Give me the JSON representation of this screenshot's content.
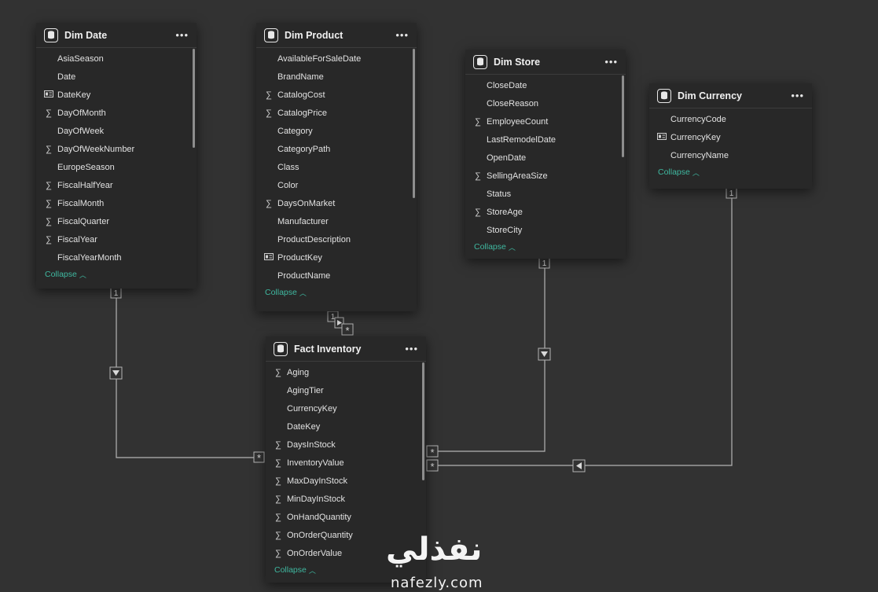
{
  "tables": {
    "dim_date": {
      "title": "Dim Date",
      "fields": [
        {
          "label": "AsiaSeason",
          "icon": ""
        },
        {
          "label": "Date",
          "icon": ""
        },
        {
          "label": "DateKey",
          "icon": "key-card"
        },
        {
          "label": "DayOfMonth",
          "icon": "sigma"
        },
        {
          "label": "DayOfWeek",
          "icon": ""
        },
        {
          "label": "DayOfWeekNumber",
          "icon": "sigma"
        },
        {
          "label": "EuropeSeason",
          "icon": ""
        },
        {
          "label": "FiscalHalfYear",
          "icon": "sigma"
        },
        {
          "label": "FiscalMonth",
          "icon": "sigma"
        },
        {
          "label": "FiscalQuarter",
          "icon": "sigma"
        },
        {
          "label": "FiscalYear",
          "icon": "sigma"
        },
        {
          "label": "FiscalYearMonth",
          "icon": ""
        }
      ],
      "collapse": "Collapse"
    },
    "dim_product": {
      "title": "Dim Product",
      "fields": [
        {
          "label": "AvailableForSaleDate",
          "icon": ""
        },
        {
          "label": "BrandName",
          "icon": ""
        },
        {
          "label": "CatalogCost",
          "icon": "sigma"
        },
        {
          "label": "CatalogPrice",
          "icon": "sigma"
        },
        {
          "label": "Category",
          "icon": ""
        },
        {
          "label": "CategoryPath",
          "icon": ""
        },
        {
          "label": "Class",
          "icon": ""
        },
        {
          "label": "Color",
          "icon": ""
        },
        {
          "label": "DaysOnMarket",
          "icon": "sigma"
        },
        {
          "label": "Manufacturer",
          "icon": ""
        },
        {
          "label": "ProductDescription",
          "icon": ""
        },
        {
          "label": "ProductKey",
          "icon": "key-card"
        },
        {
          "label": "ProductName",
          "icon": ""
        }
      ],
      "collapse": "Collapse"
    },
    "dim_store": {
      "title": "Dim Store",
      "fields": [
        {
          "label": "CloseDate",
          "icon": ""
        },
        {
          "label": "CloseReason",
          "icon": ""
        },
        {
          "label": "EmployeeCount",
          "icon": "sigma"
        },
        {
          "label": "LastRemodelDate",
          "icon": ""
        },
        {
          "label": "OpenDate",
          "icon": ""
        },
        {
          "label": "SellingAreaSize",
          "icon": "sigma"
        },
        {
          "label": "Status",
          "icon": ""
        },
        {
          "label": "StoreAge",
          "icon": "sigma"
        },
        {
          "label": "StoreCity",
          "icon": ""
        }
      ],
      "collapse": "Collapse"
    },
    "dim_currency": {
      "title": "Dim Currency",
      "fields": [
        {
          "label": "CurrencyCode",
          "icon": ""
        },
        {
          "label": "CurrencyKey",
          "icon": "key-card"
        },
        {
          "label": "CurrencyName",
          "icon": ""
        }
      ],
      "collapse": "Collapse"
    },
    "fact_inventory": {
      "title": "Fact Inventory",
      "fields": [
        {
          "label": "Aging",
          "icon": "sigma"
        },
        {
          "label": "AgingTier",
          "icon": ""
        },
        {
          "label": "CurrencyKey",
          "icon": ""
        },
        {
          "label": "DateKey",
          "icon": ""
        },
        {
          "label": "DaysInStock",
          "icon": "sigma"
        },
        {
          "label": "InventoryValue",
          "icon": "sigma"
        },
        {
          "label": "MaxDayInStock",
          "icon": "sigma"
        },
        {
          "label": "MinDayInStock",
          "icon": "sigma"
        },
        {
          "label": "OnHandQuantity",
          "icon": "sigma"
        },
        {
          "label": "OnOrderQuantity",
          "icon": "sigma"
        },
        {
          "label": "OnOrderValue",
          "icon": "sigma"
        }
      ],
      "collapse": "Collapse"
    }
  },
  "cardinality": {
    "one": "1",
    "many": "*"
  },
  "watermark": {
    "arabic": "نفذلي",
    "latin": "nafezly.com"
  },
  "colors": {
    "background": "#323232",
    "card": "#282828",
    "accent": "#3fb8a0",
    "line": "#b4b4b4"
  }
}
